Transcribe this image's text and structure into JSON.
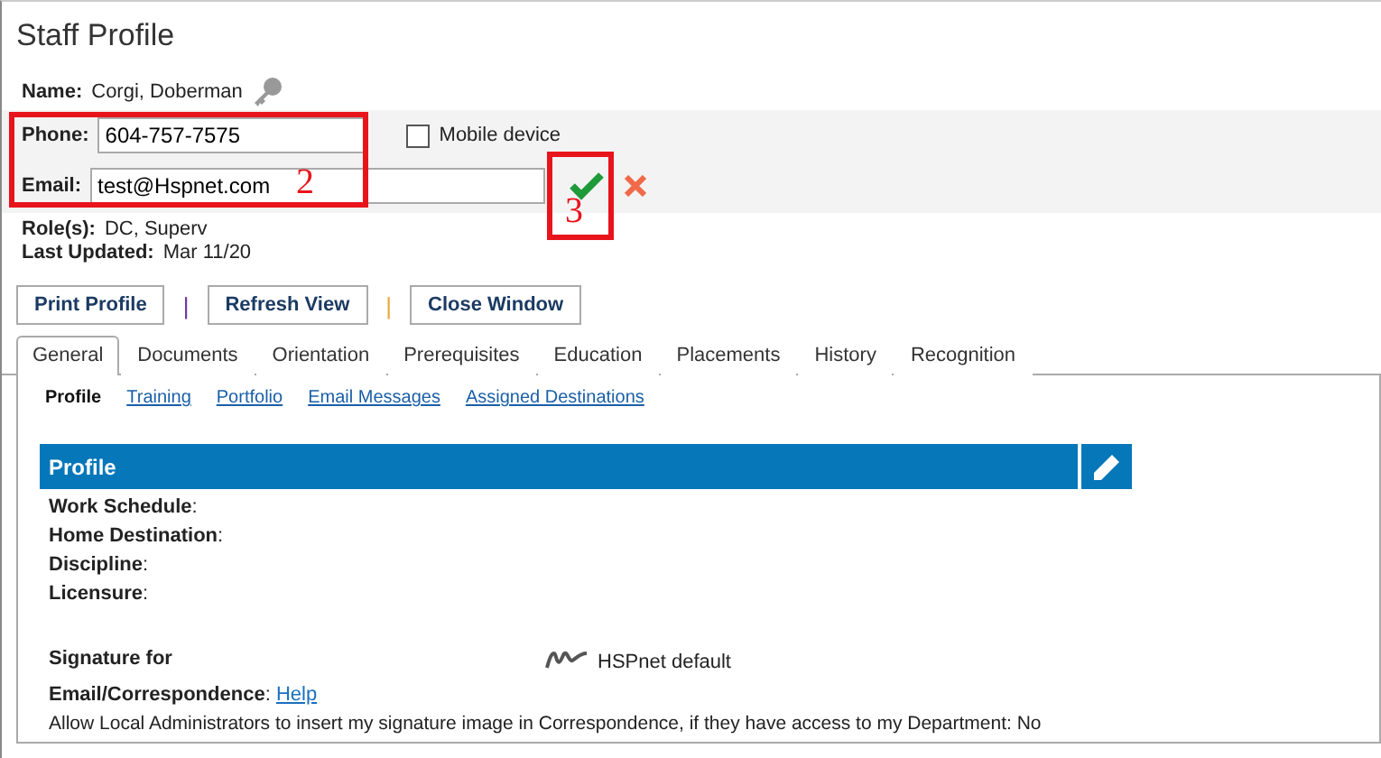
{
  "window": {
    "title": "Staff Profile"
  },
  "name": {
    "label": "Name:",
    "value": "Corgi, Doberman"
  },
  "phone": {
    "label": "Phone:",
    "value": "604-757-7575"
  },
  "mobile_device": {
    "label": "Mobile device",
    "checked": false
  },
  "email": {
    "label": "Email:",
    "value": "test@Hspnet.com"
  },
  "roles": {
    "label": "Role(s):",
    "value": "DC, Superv"
  },
  "last_updated": {
    "label": "Last Updated:",
    "value": "Mar 11/20"
  },
  "buttons": [
    {
      "label": "Print Profile",
      "separator": {
        "text": "|",
        "color": "#7030a0"
      }
    },
    {
      "label": "Refresh View",
      "separator": {
        "text": "|",
        "color": "#e8a838"
      }
    },
    {
      "label": "Close Window"
    }
  ],
  "tabs": [
    {
      "label": "General",
      "selected": true
    },
    {
      "label": "Documents",
      "selected": false
    },
    {
      "label": "Orientation",
      "selected": false
    },
    {
      "label": "Prerequisites",
      "selected": false
    },
    {
      "label": "Education",
      "selected": false
    },
    {
      "label": "Placements",
      "selected": false
    },
    {
      "label": "History",
      "selected": false
    },
    {
      "label": "Recognition",
      "selected": false
    }
  ],
  "sub_tabs": [
    {
      "label": "Profile",
      "selected": true
    },
    {
      "label": "Training",
      "selected": false
    },
    {
      "label": "Portfolio",
      "selected": false
    },
    {
      "label": "Email Messages",
      "selected": false
    },
    {
      "label": "Assigned Destinations",
      "selected": false
    }
  ],
  "section": {
    "title": "Profile"
  },
  "fields": [
    "**Work Schedule**:",
    "**Home Destination**:",
    "**Discipline**:",
    "**Licensure**:"
  ],
  "signature": {
    "label": "Signature for",
    "value": "HSPnet default",
    "label_2": "**Email/Correspondence**:",
    "help_link": "Help"
  },
  "note": "Allow Local Administrators to insert my signature image in Correspondence, if they have access to my Department: No",
  "annotations": [
    {
      "number": "2"
    },
    {
      "number": "3"
    }
  ]
}
